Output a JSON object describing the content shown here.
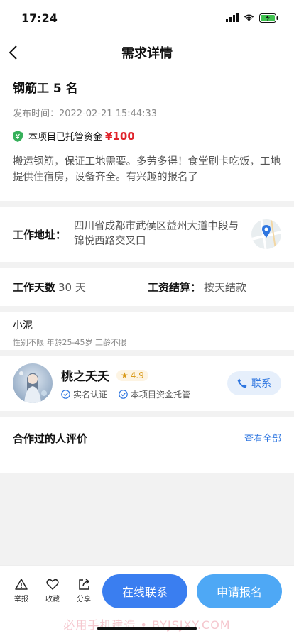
{
  "status": {
    "time": "17:24"
  },
  "nav": {
    "title": "需求详情"
  },
  "job": {
    "title": "钢筋工 5 名",
    "publish_label": "发布时间：",
    "publish_time": "2022-02-21 15:44:33",
    "escrow_label": "本项目已托管资金",
    "escrow_amount": "¥100",
    "description": "搬运钢筋，保证工地需要。多劳多得！食堂刷卡吃饭，工地提供住宿房，设备齐全。有兴趣的报名了"
  },
  "address": {
    "label": "工作地址：",
    "value": "四川省成都市武侯区益州大道中段与锦悦西路交叉口"
  },
  "meta": {
    "days_label": "工作天数",
    "days_value": "30 天",
    "pay_label": "工资结算：",
    "pay_value": "按天结款"
  },
  "requirements": {
    "name": "小泥",
    "detail": "性别不限 年龄25-45岁 工龄不限"
  },
  "employer": {
    "name": "桃之夭夭",
    "rating": "4.9",
    "badge1": "实名认证",
    "badge2": "本项目资金托管",
    "contact": "联系"
  },
  "reviews": {
    "title": "合作过的人评价",
    "more": "查看全部"
  },
  "bottom": {
    "report": "举报",
    "favorite": "收藏",
    "share": "分享",
    "online_contact": "在线联系",
    "apply": "申请报名",
    "watermark": "必用手机建造 • BYJSJXY.COM"
  },
  "colors": {
    "accent": "#3a7ef0",
    "price": "#e0232b",
    "rating": "#d99a1a"
  }
}
